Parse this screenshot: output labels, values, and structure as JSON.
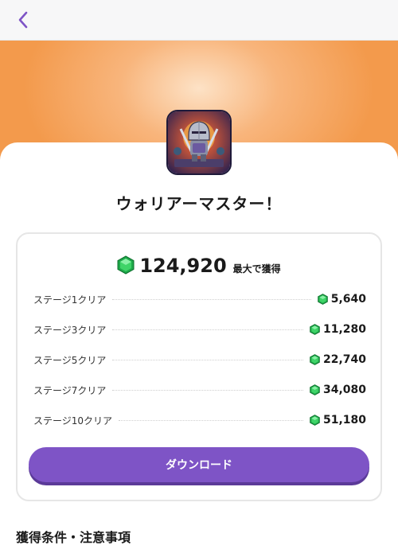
{
  "nav": {
    "back_icon": "chevron-left-icon",
    "accent": "#7e54c6"
  },
  "app": {
    "title": "ウォリアーマスター！",
    "icon": "knight-icon"
  },
  "rewards": {
    "gem_icon": "green-gem-icon",
    "total_amount": "124,920",
    "total_suffix": "最大で獲得",
    "rows": [
      {
        "label": "ステージ1クリア",
        "value": "5,640"
      },
      {
        "label": "ステージ3クリア",
        "value": "11,280"
      },
      {
        "label": "ステージ5クリア",
        "value": "22,740"
      },
      {
        "label": "ステージ7クリア",
        "value": "34,080"
      },
      {
        "label": "ステージ10クリア",
        "value": "51,180"
      }
    ],
    "download_label": "ダウンロード"
  },
  "terms": {
    "title": "獲得条件・注意事項"
  }
}
